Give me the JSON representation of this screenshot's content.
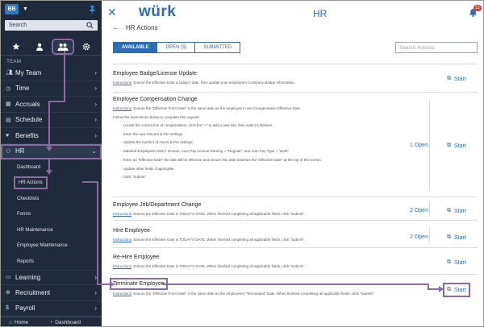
{
  "sidebar": {
    "avatar": "BB",
    "search_placeholder": "Search",
    "team_label": "TEAM",
    "items": [
      {
        "label": "My Team",
        "icon": "users-icon"
      },
      {
        "label": "Time",
        "icon": "clock-icon"
      },
      {
        "label": "Accruals",
        "icon": "accruals-icon"
      },
      {
        "label": "Schedule",
        "icon": "calendar-icon"
      },
      {
        "label": "Benefits",
        "icon": "heart-icon"
      },
      {
        "label": "HR",
        "icon": "hr-icon"
      }
    ],
    "hr_sub": [
      "Dashboard",
      "HR Actions",
      "Checklists",
      "Forms",
      "HR Maintenance",
      "Employee Maintenance",
      "Reports"
    ],
    "items_after": [
      {
        "label": "Learning",
        "icon": "learning-icon"
      },
      {
        "label": "Recruitment",
        "icon": "recruitment-icon"
      },
      {
        "label": "Payroll",
        "icon": "payroll-icon"
      }
    ],
    "bottom_home": "Home",
    "bottom_dashboard": "Dashboard"
  },
  "header": {
    "logo": "würk",
    "title": "HR",
    "notification_count": "13"
  },
  "page": {
    "back_label": "HR Actions",
    "tabs": [
      "AVAILABLE",
      "OPEN (5)",
      "SUBMITTED"
    ],
    "search_placeholder": "Search Actions",
    "start_label": "Start"
  },
  "actions": [
    {
      "title": "Employee Badge/License Update",
      "desc_link": "Instructions",
      "desc": ": Ensure the Effective Date is today's date, then update your employee's Company Badge information."
    },
    {
      "title": "Employee Compensation Change",
      "desc_link": "Instructions",
      "desc": ": Ensure the \"Effective From Date\" is the same date as the employee's new Compensation Effective Date.",
      "follow": "Follow the instructions below to complete this request:",
      "steps": [
        "- Locate the current line of compensation, click the \"+\" to add a new line, then select a Reason.",
        "- Enter the new Amount & Per settings.",
        "- Update the number of Hours & Per settings.",
        "- Salaried Employees ONLY: Ensure, Auto Pay Amount Earning = \"Regular\", and Auto Pay Type = \"Both\"",
        "- Enter an \"Effective Date\" the rate will be effective and ensure this date matches the \"Effective Date\" at the top of the screen.",
        "- Update other fields if applicable.",
        "- Click \"Submit\""
      ],
      "open": "1 Open"
    },
    {
      "title": "Employee Job/Department Change",
      "desc_link": "Instructions",
      "desc": ": Ensure the Effective Date is TODAY'S DATE. When finished completing all applicable fields, click \"Submit\".",
      "open": "2 Open"
    },
    {
      "title": "Hire Employee",
      "desc_link": "Instructions",
      "desc": ": Ensure the Effective Date is TODAY'S DATE. When finished completing all applicable fields, click \"Submit\".",
      "open": "2 Open"
    },
    {
      "title": "Re-Hire Employee",
      "desc_link": "Instructions",
      "desc": ": Ensure the Effective Date is TODAY'S DATE. When finished completing all applicable fields, click \"Submit\"."
    },
    {
      "title": "Terminate Employee",
      "desc_link": "Instructions",
      "desc": ": Ensure the \"Effective From Date\" is the same date as the employee's \"Terminated\" Date. When finished completing all applicable fields, click \"Submit\"."
    }
  ],
  "colors": {
    "accent": "#2f6db3",
    "sidebar_bg": "#1f2a3a",
    "highlight": "#8d6a9f",
    "badge": "#e23b2e"
  }
}
